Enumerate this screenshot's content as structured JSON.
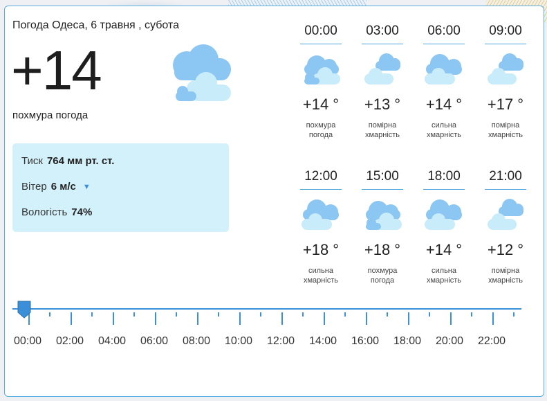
{
  "header": {
    "title": "Погода Одеса, 6 травня , субота"
  },
  "current": {
    "temperature": "+14",
    "condition": "похмура погода",
    "icon": "cloudy-icon"
  },
  "details": {
    "pressure_label": "Тиск",
    "pressure_value": "764 мм рт. ст.",
    "wind_label": "Вітер",
    "wind_value": "6 м/с",
    "wind_icon": "wind-direction-down-icon",
    "humidity_label": "Вологість",
    "humidity_value": "74%"
  },
  "forecast": [
    {
      "time": "00:00",
      "temp": "+14 °",
      "desc1": "похмура",
      "desc2": "погода",
      "icon": "overcast-icon"
    },
    {
      "time": "03:00",
      "temp": "+13 °",
      "desc1": "помірна",
      "desc2": "хмарність",
      "icon": "partly-cloudy-icon"
    },
    {
      "time": "06:00",
      "temp": "+14 °",
      "desc1": "сильна",
      "desc2": "хмарність",
      "icon": "cloudy-icon"
    },
    {
      "time": "09:00",
      "temp": "+17 °",
      "desc1": "помірна",
      "desc2": "хмарність",
      "icon": "partly-cloudy-icon"
    },
    {
      "time": "12:00",
      "temp": "+18 °",
      "desc1": "сильна",
      "desc2": "хмарність",
      "icon": "cloudy-icon"
    },
    {
      "time": "15:00",
      "temp": "+18 °",
      "desc1": "похмура",
      "desc2": "погода",
      "icon": "overcast-icon"
    },
    {
      "time": "18:00",
      "temp": "+14 °",
      "desc1": "сильна",
      "desc2": "хмарність",
      "icon": "cloudy-icon"
    },
    {
      "time": "21:00",
      "temp": "+12 °",
      "desc1": "помірна",
      "desc2": "хмарність",
      "icon": "partly-cloudy-icon"
    }
  ],
  "timeline": {
    "labels": [
      "00:00",
      "02:00",
      "04:00",
      "06:00",
      "08:00",
      "10:00",
      "12:00",
      "14:00",
      "16:00",
      "18:00",
      "20:00",
      "22:00"
    ],
    "selected": "00:00"
  },
  "colors": {
    "accent": "#3a8fd8",
    "border": "#5aaee0",
    "info_bg": "#d3f1fa",
    "cloud_dark": "#8cc6f2",
    "cloud_light": "#c9ecfa"
  }
}
